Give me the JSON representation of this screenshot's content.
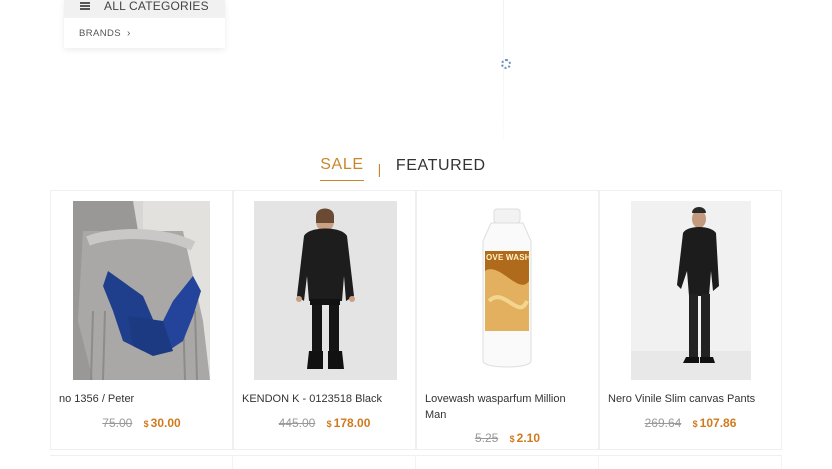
{
  "menu": {
    "all_categories": "ALL CATEGORIES",
    "brands": "BRANDS"
  },
  "tabs": {
    "sale": "SALE",
    "separator": "|",
    "featured": "FEATURED"
  },
  "products": [
    {
      "title": "no 1356 / Peter",
      "old_price": "75.00",
      "currency": "$",
      "new_price": "30.00"
    },
    {
      "title": "KENDON K - 0123518 Black",
      "old_price": "445.00",
      "currency": "$",
      "new_price": "178.00"
    },
    {
      "title": "Lovewash wasparfum Million Man",
      "old_price": "5.25",
      "currency": "$",
      "new_price": "2.10"
    },
    {
      "title": "Nero Vinile Slim canvas Pants",
      "old_price": "269.64",
      "currency": "$",
      "new_price": "107.86"
    }
  ],
  "bottle_label": "OVE WASH",
  "colors": {
    "accent": "#c8872b",
    "price": "#d07a1e",
    "old_price": "#999999"
  }
}
